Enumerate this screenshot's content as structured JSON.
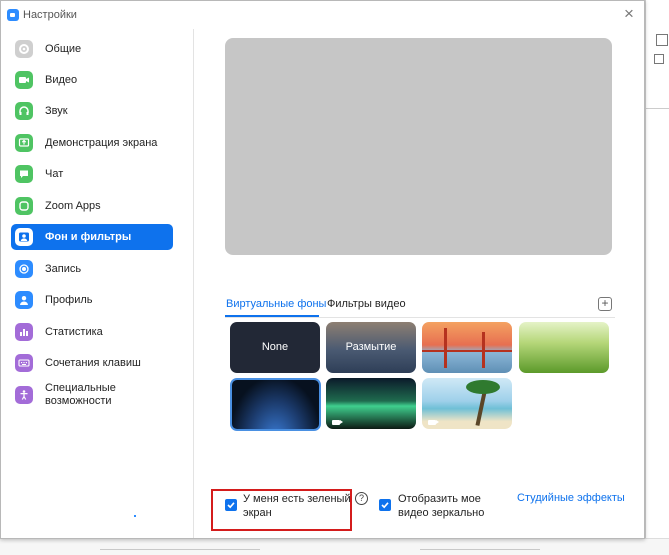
{
  "window": {
    "title": "Настройки"
  },
  "sidebar": {
    "items": [
      {
        "label": "Общие",
        "icon": "gear-icon",
        "color": "#c9c9c9"
      },
      {
        "label": "Видео",
        "icon": "video-camera-icon",
        "color": "#4fc463"
      },
      {
        "label": "Звук",
        "icon": "headphones-icon",
        "color": "#4fc463"
      },
      {
        "label": "Демонстрация экрана",
        "icon": "share-screen-icon",
        "color": "#4fc463"
      },
      {
        "label": "Чат",
        "icon": "chat-bubble-icon",
        "color": "#4fc463"
      },
      {
        "label": "Zoom Apps",
        "icon": "zoom-apps-icon",
        "color": "#4fc463"
      },
      {
        "label": "Фон и фильтры",
        "icon": "background-portrait-icon",
        "color": "#0e72ed",
        "active": true
      },
      {
        "label": "Запись",
        "icon": "record-icon",
        "color": "#2d8cff"
      },
      {
        "label": "Профиль",
        "icon": "profile-icon",
        "color": "#2d8cff"
      },
      {
        "label": "Статистика",
        "icon": "statistics-icon",
        "color": "#a36cd8"
      },
      {
        "label": "Сочетания клавиш",
        "icon": "keyboard-icon",
        "color": "#a36cd8"
      },
      {
        "label": "Специальные возможности",
        "icon": "accessibility-icon",
        "color": "#a36cd8"
      }
    ]
  },
  "tabs": {
    "virtual": "Виртуальные фоны",
    "filters": "Фильтры видео"
  },
  "backgrounds": [
    {
      "label": "None"
    },
    {
      "label": "Размытие"
    }
  ],
  "options": {
    "green_screen": "У меня есть зеленый экран",
    "mirror": "Отобразить мое видео зеркально",
    "studio_effects": "Студийные эффекты"
  },
  "colors": {
    "accent": "#0e72ed",
    "highlight_box": "#d41c1c"
  }
}
